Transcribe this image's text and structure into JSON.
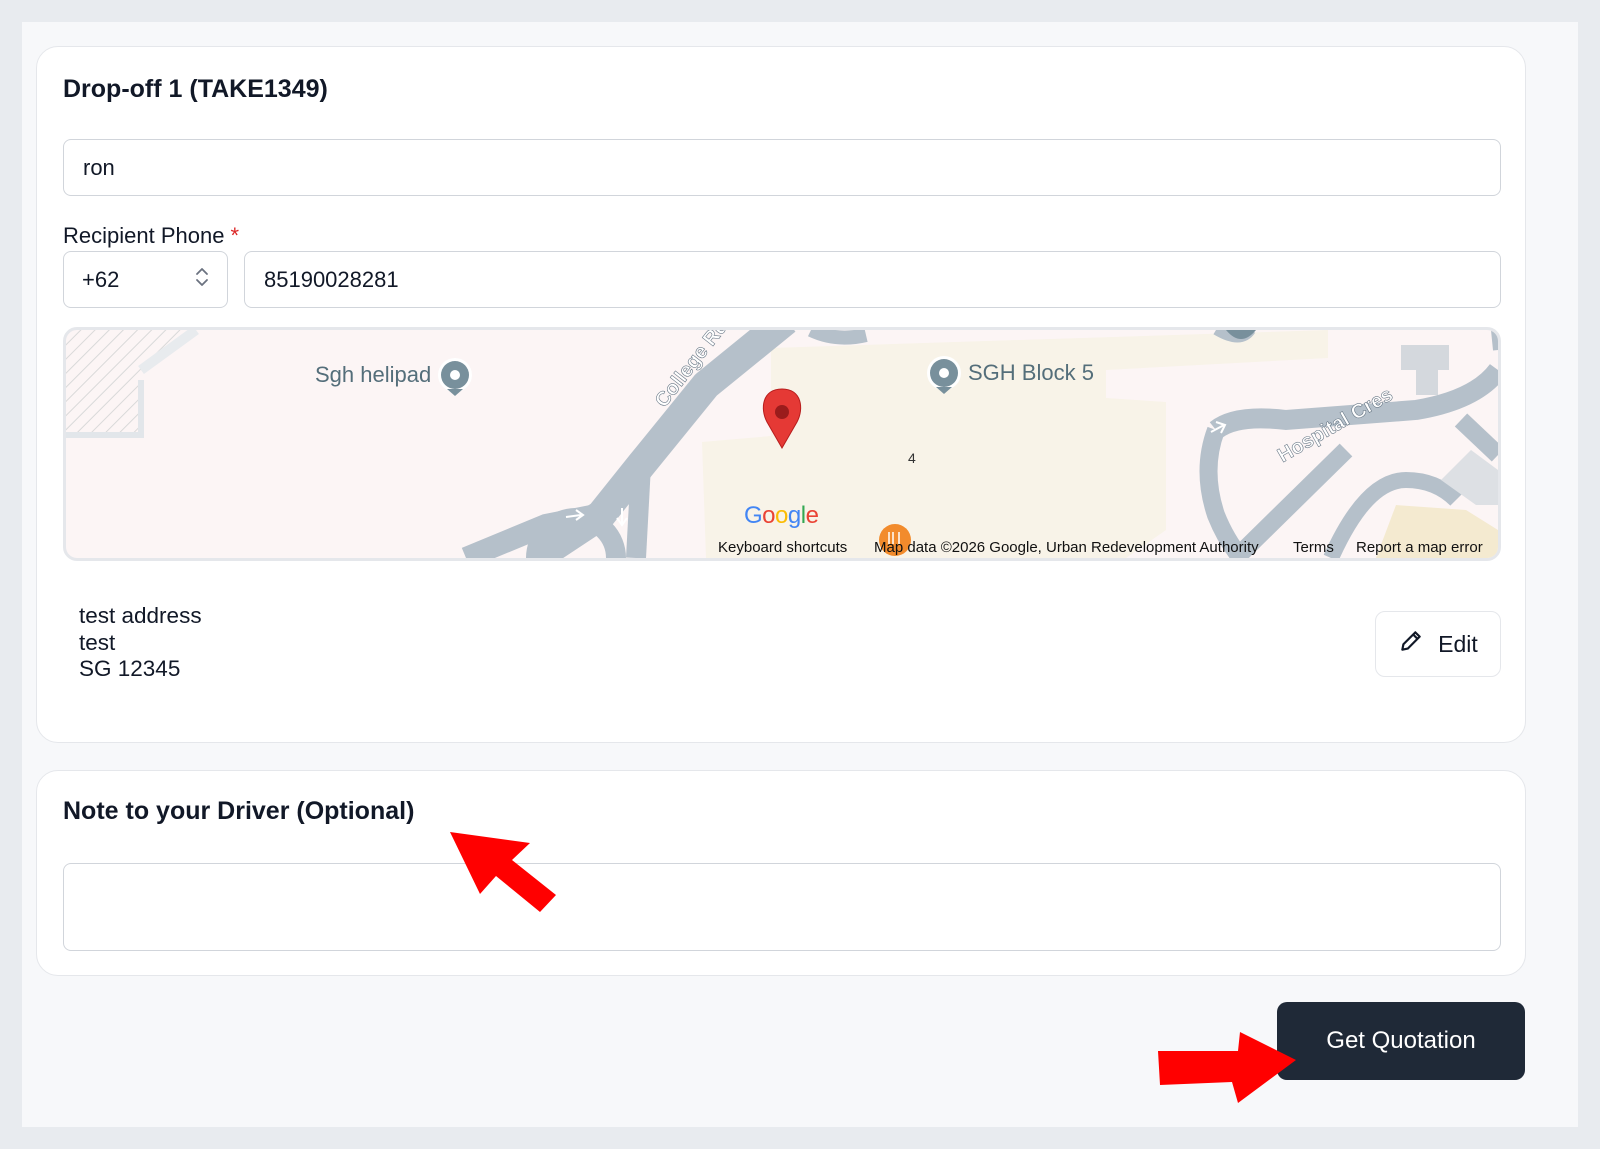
{
  "dropoff": {
    "title": "Drop-off 1 (TAKE1349)",
    "recipient_name_value": "ron",
    "phone_label": "Recipient Phone",
    "required_mark": "*",
    "country_code": "+62",
    "phone_value": "85190028281"
  },
  "map": {
    "places": {
      "helipad": "Sgh helipad",
      "block5": "SGH Block 5",
      "college_road": "College Rd",
      "hospital_cres": "Hospital Cres",
      "building_number": "4"
    },
    "logo": "Google",
    "footer": {
      "shortcuts": "Keyboard shortcuts",
      "map_data": "Map data ©2026 Google, Urban Redevelopment Authority",
      "terms": "Terms",
      "report": "Report a map error"
    },
    "colors": {
      "road": "#b5c0ca",
      "building": "#f8f3e8",
      "pin": "#e53935"
    }
  },
  "address": {
    "line1": "test address",
    "line2": "test",
    "line3": "SG 12345"
  },
  "edit_label": "Edit",
  "note": {
    "title": "Note to your Driver (Optional)",
    "value": ""
  },
  "quote_button_label": "Get Quotation",
  "colors": {
    "primary_button": "#1f2937",
    "required": "#dc2626",
    "annotation_arrow": "#ff0000"
  }
}
